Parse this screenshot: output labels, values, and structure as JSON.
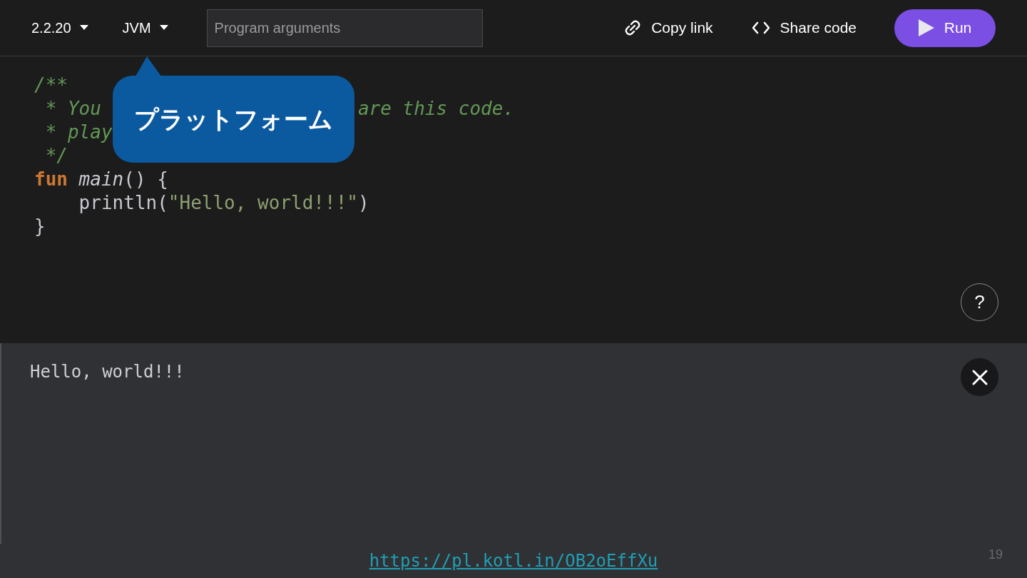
{
  "toolbar": {
    "version": "2.2.20",
    "platform": "JVM",
    "arguments": {
      "placeholder": "Program arguments"
    },
    "copy_link": "Copy link",
    "share_code": "Share code",
    "run": "Run"
  },
  "callout": {
    "text": "プラットフォーム"
  },
  "code": [
    [
      {
        "kind": "comment",
        "text": "/**"
      }
    ],
    [
      {
        "kind": "comment",
        "text": " * You"
      },
      {
        "kind": "comment",
        "text": "are this code."
      }
    ],
    [
      {
        "kind": "comment",
        "text": " * play"
      }
    ],
    [
      {
        "kind": "comment",
        "text": " */"
      }
    ],
    [
      {
        "kind": "keyword",
        "text": "fun"
      },
      {
        "kind": "function",
        "text": "main",
        "gap": true
      },
      {
        "kind": "plain",
        "text": "() {"
      }
    ],
    [
      {
        "kind": "plain",
        "text": "    println("
      },
      {
        "kind": "string",
        "text": "\"Hello, world!!!\""
      },
      {
        "kind": "plain",
        "text": ")"
      }
    ],
    [
      {
        "kind": "plain",
        "text": "}"
      }
    ]
  ],
  "help": "?",
  "output": {
    "text": "Hello, world!!!"
  },
  "slide": {
    "page_number": "19",
    "link": "https://pl.kotl.in/OB2oEffXu"
  }
}
